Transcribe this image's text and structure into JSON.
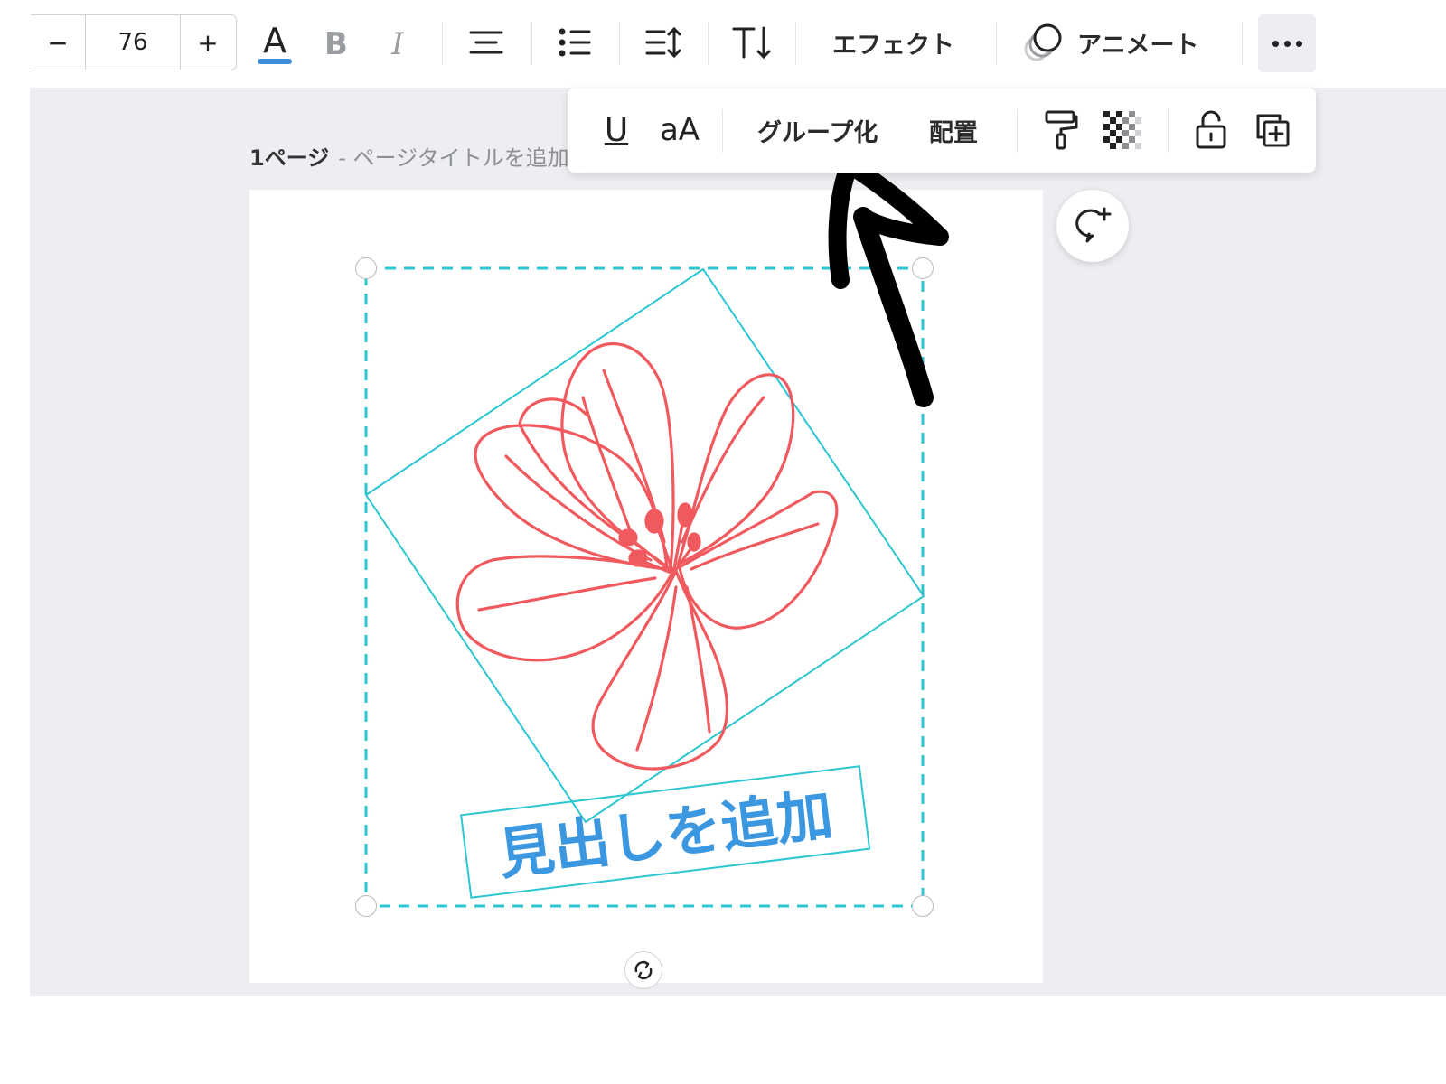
{
  "toolbar": {
    "font_size_value": "76",
    "minus_label": "−",
    "plus_label": "+",
    "effects_label": "エフェクト",
    "animate_label": "アニメート",
    "text_color_accent": "#3b8edb",
    "icons": [
      "text-color-icon",
      "bold-icon",
      "italic-icon",
      "align-center-icon",
      "list-icon",
      "line-spacing-icon",
      "text-direction-icon",
      "animate-icon",
      "more-icon"
    ]
  },
  "floatbar": {
    "underline_label": "U",
    "case_label": "aA",
    "group_label": "グループ化",
    "arrange_label": "配置",
    "icons": [
      "paint-roller-icon",
      "transparency-icon",
      "lock-icon",
      "duplicate-icon"
    ]
  },
  "page": {
    "number_label": "1ページ",
    "title_placeholder": "- ページタイトルを追加"
  },
  "canvas": {
    "heading_text": "見出しを追加",
    "heading_color": "#3a97e0",
    "flower_color": "#f05a5f",
    "selection_color": "#2bc6d2"
  }
}
